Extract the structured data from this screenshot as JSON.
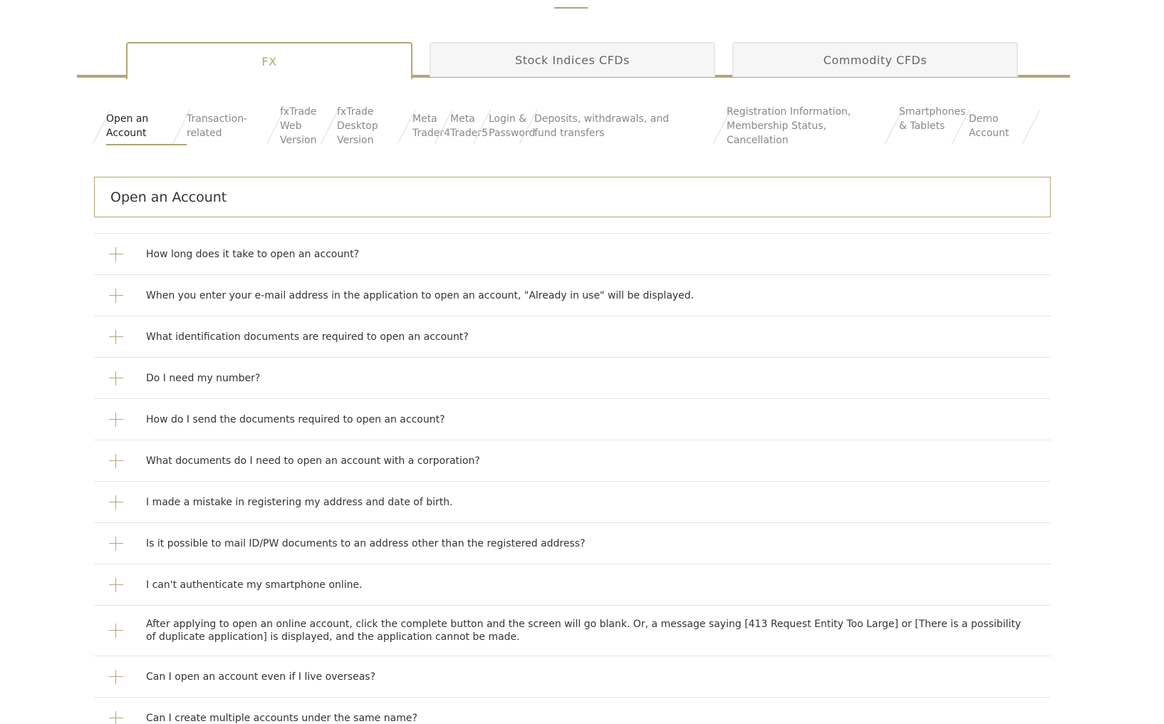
{
  "product_tabs": [
    {
      "label": "FX",
      "active": true
    },
    {
      "label": "Stock Indices CFDs",
      "active": false
    },
    {
      "label": "Commodity CFDs",
      "active": false
    }
  ],
  "categories": [
    {
      "label": "Open an Account",
      "active": true
    },
    {
      "label": "Transaction-related"
    },
    {
      "label": "fxTrade Web Version"
    },
    {
      "label": "fxTrade Desktop Version"
    },
    {
      "label": "Meta Trader4"
    },
    {
      "label": "Meta Trader5"
    },
    {
      "label": "Login & Password"
    },
    {
      "label": "Deposits, withdrawals, and fund transfers"
    },
    {
      "label": "Registration Information, Membership Status, Cancellation"
    },
    {
      "label": "Smartphones & Tablets"
    },
    {
      "label": "Demo Account"
    }
  ],
  "section_title": "Open an Account",
  "faqs": [
    "How long does it take to open an account?",
    "When you enter your e-mail address in the application to open an account, \"Already in use\" will be displayed.",
    "What identification documents are required to open an account?",
    "Do I need my number?",
    "How do I send the documents required to open an account?",
    "What documents do I need to open an account with a corporation?",
    "I made a mistake in registering my address and date of birth.",
    "Is it possible to mail ID/PW documents to an address other than the registered address?",
    "I can't authenticate my smartphone online.",
    "After applying to open an online account, click the complete button and the screen will go blank. Or, a message saying [413 Request Entity Too Large] or [There is a possibility of duplicate application] is displayed, and the application cannot be made.",
    "Can I open an account even if I live overseas?",
    "Can I create multiple accounts under the same name?"
  ],
  "colors": {
    "accent": "#b3a574",
    "text": "#333333",
    "muted": "#888888"
  }
}
